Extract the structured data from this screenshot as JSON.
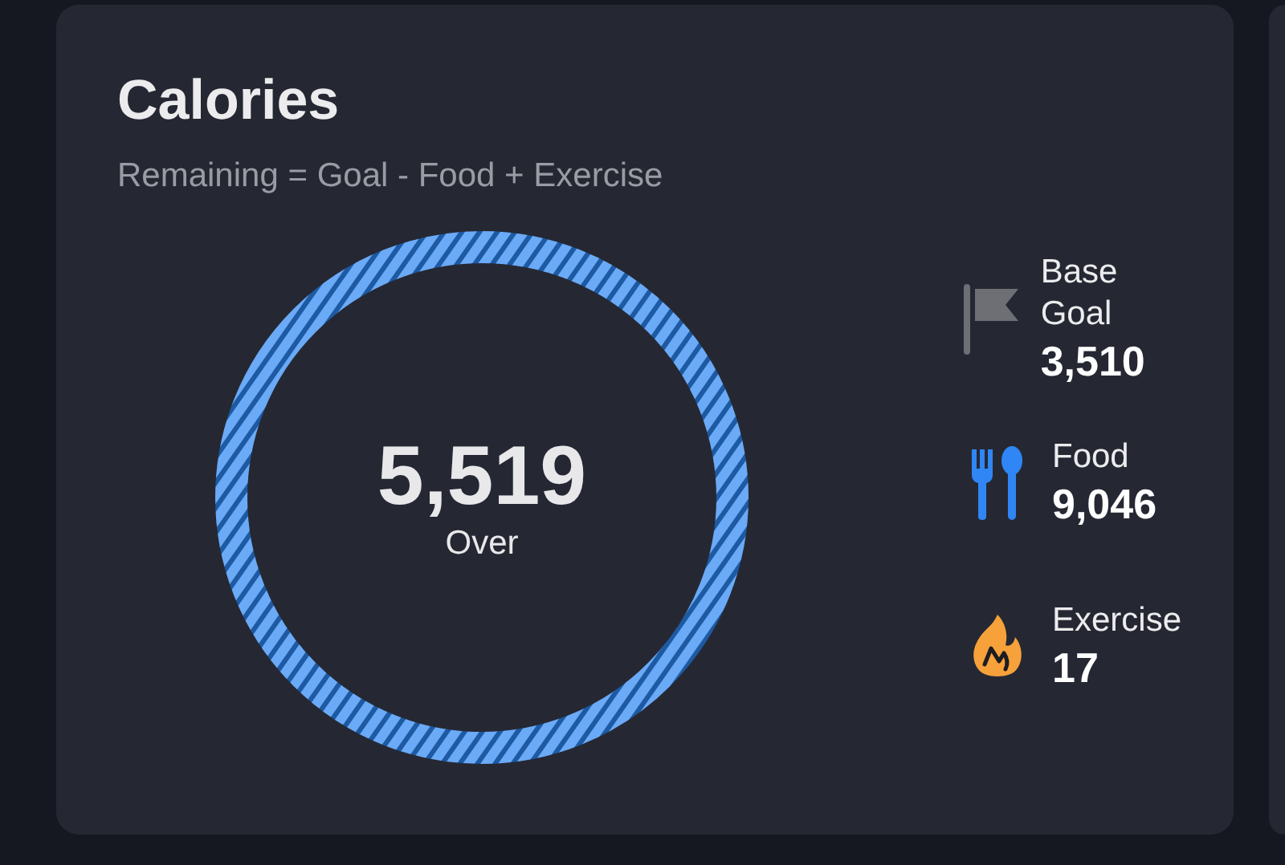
{
  "card": {
    "title": "Calories",
    "subtitle": "Remaining = Goal - Food + Exercise"
  },
  "ring": {
    "value": "5,519",
    "caption": "Over",
    "over": true
  },
  "stats": [
    {
      "kind": "goal",
      "label": "Base Goal",
      "value": "3,510"
    },
    {
      "kind": "food",
      "label": "Food",
      "value": "9,046"
    },
    {
      "kind": "exercise",
      "label": "Exercise",
      "value": "17"
    }
  ]
}
